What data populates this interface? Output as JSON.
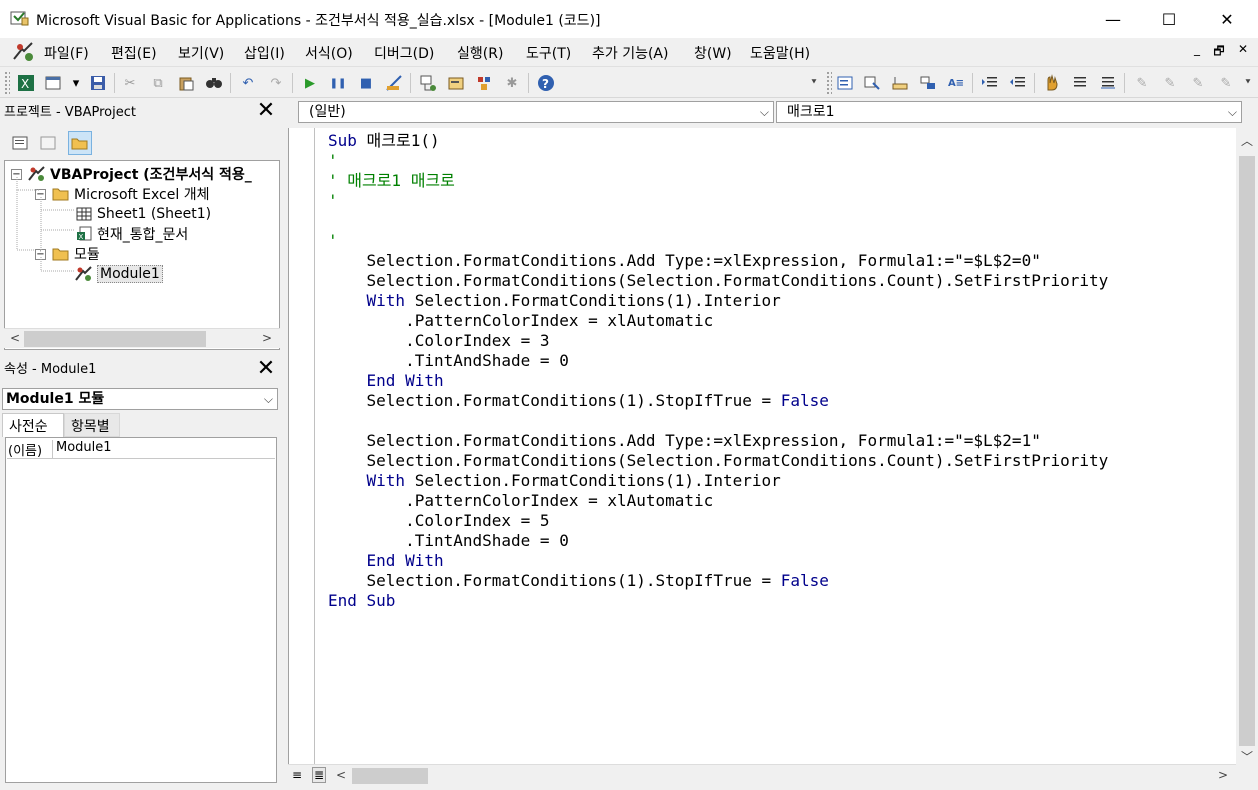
{
  "window": {
    "title": "Microsoft Visual Basic for Applications - 조건부서식 적용_실습.xlsx - [Module1 (코드)]",
    "minimize": "—",
    "maximize": "☐",
    "close": "✕"
  },
  "menu": {
    "items": [
      "파일(F)",
      "편집(E)",
      "보기(V)",
      "삽입(I)",
      "서식(O)",
      "디버그(D)",
      "실행(R)",
      "도구(T)",
      "추가 기능(A)",
      "창(W)",
      "도움말(H)"
    ],
    "mdi_min": "_",
    "mdi_restore": "🗗",
    "mdi_close": "✕"
  },
  "project_pane": {
    "title": "프로젝트 - VBAProject",
    "close": "✕",
    "tree": {
      "root": "VBAProject (조건부서식 적용_",
      "excel_objects": "Microsoft Excel 개체",
      "sheet1": "Sheet1 (Sheet1)",
      "workbook": "현재_통합_문서",
      "modules": "모듈",
      "module1": "Module1"
    }
  },
  "properties_pane": {
    "title": "속성 - Module1",
    "close": "✕",
    "object_combo": "Module1 모듈",
    "tab_alpha": "사전순",
    "tab_category": "항목별",
    "row_name": "(이름)",
    "row_value": "Module1"
  },
  "code_window": {
    "object_combo": "(일반)",
    "procedure_combo": "매크로1"
  },
  "colors": {
    "keyword": "#00008b",
    "comment": "#008000",
    "background": "#ffffff"
  }
}
